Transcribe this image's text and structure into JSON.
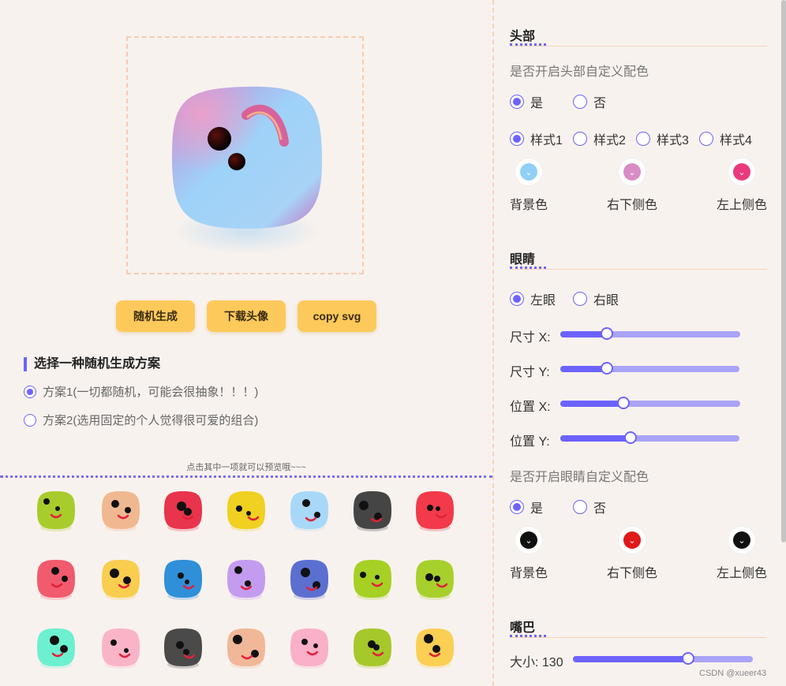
{
  "left": {
    "buttons": {
      "random": "随机生成",
      "download": "下载头像",
      "copy": "copy svg"
    },
    "scheme": {
      "title": "选择一种随机生成方案",
      "options": [
        {
          "label": "方案1(一切都随机，可能会很抽象！！！)",
          "selected": true
        },
        {
          "label": "方案2(选用固定的个人觉得很可爱的组合)",
          "selected": false
        }
      ]
    },
    "hint": "点击其中一项就可以预览哦~~~",
    "gallery_colors": [
      [
        "#a8cc2c",
        "#f0b890",
        "#e8344c",
        "#f0d020",
        "#a8d8f8",
        "#454545",
        "#f23a4a"
      ],
      [
        "#f25a6e",
        "#f9cd4e",
        "#2f8fd8",
        "#c39cf0",
        "#5b6fd1",
        "#a6d024",
        "#a8d02c"
      ],
      [
        "#6df0d0",
        "#f9b4c8",
        "#4a4a4a",
        "#f0b898",
        "#f9b0c8",
        "#a6c82a",
        "#fbcf54"
      ]
    ]
  },
  "right": {
    "head": {
      "title": "头部",
      "custom_label": "是否开启头部自定义配色",
      "yes": "是",
      "no": "否",
      "styles": [
        "样式1",
        "样式2",
        "样式3",
        "样式4"
      ],
      "swatches": [
        {
          "label": "背景色",
          "color": "#8fd0f6"
        },
        {
          "label": "右下侧色",
          "color": "#d98cc4"
        },
        {
          "label": "左上侧色",
          "color": "#ea3a7e"
        }
      ]
    },
    "eyes": {
      "title": "眼睛",
      "left": "左眼",
      "right": "右眼",
      "sliders": [
        {
          "label": "尺寸 X:",
          "fraction": 0.26
        },
        {
          "label": "尺寸 Y:",
          "fraction": 0.26
        },
        {
          "label": "位置 X:",
          "fraction": 0.35
        },
        {
          "label": "位置 Y:",
          "fraction": 0.39
        }
      ],
      "custom_label": "是否开启眼睛自定义配色",
      "yes": "是",
      "no": "否",
      "swatches": [
        {
          "label": "背景色",
          "color": "#111111"
        },
        {
          "label": "右下侧色",
          "color": "#e01818"
        },
        {
          "label": "左上侧色",
          "color": "#111111"
        }
      ]
    },
    "mouth": {
      "title": "嘴巴",
      "size_label": "大小: 130",
      "size_fraction": 0.64
    }
  },
  "watermark": "CSDN @xueer43"
}
